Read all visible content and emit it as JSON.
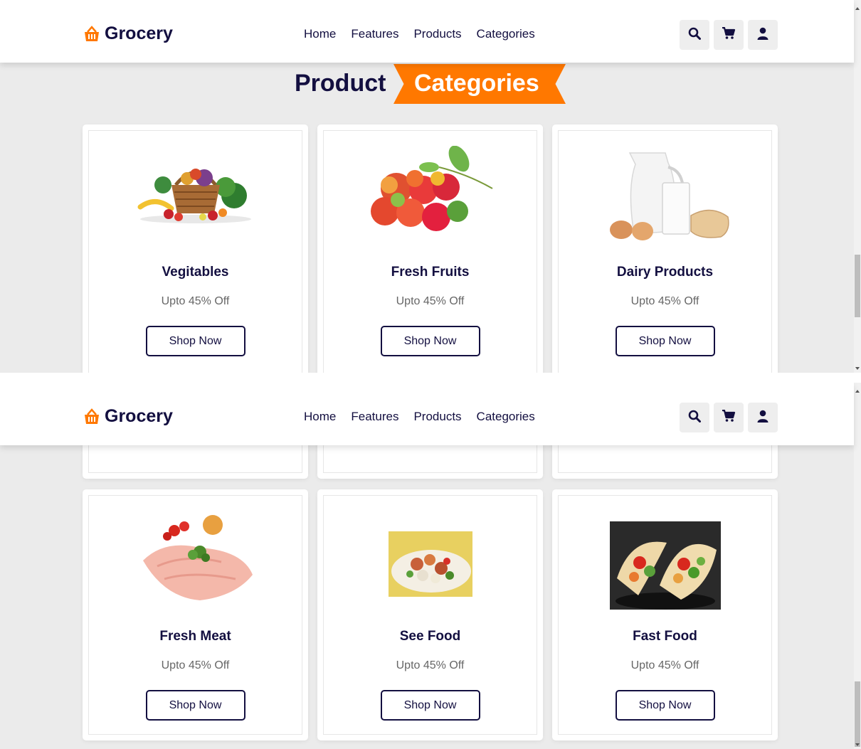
{
  "header": {
    "logo_text": "Grocery",
    "nav": [
      "Home",
      "Features",
      "Products",
      "Categories"
    ],
    "icons": [
      "search-icon",
      "cart-icon",
      "user-icon"
    ]
  },
  "heading": {
    "primary": "Product",
    "accent": "Categories"
  },
  "categories_top": [
    {
      "title": "Vegitables",
      "offer": "Upto 45% Off",
      "button": "Shop Now"
    },
    {
      "title": "Fresh Fruits",
      "offer": "Upto 45% Off",
      "button": "Shop Now"
    },
    {
      "title": "Dairy Products",
      "offer": "Upto 45% Off",
      "button": "Shop Now"
    }
  ],
  "categories_bottom": [
    {
      "title": "Fresh Meat",
      "offer": "Upto 45% Off",
      "button": "Shop Now"
    },
    {
      "title": "See Food",
      "offer": "Upto 45% Off",
      "button": "Shop Now"
    },
    {
      "title": "Fast Food",
      "offer": "Upto 45% Off",
      "button": "Shop Now"
    }
  ],
  "colors": {
    "accent": "#ff7800",
    "dark": "#130f40",
    "background": "#ebebeb"
  }
}
